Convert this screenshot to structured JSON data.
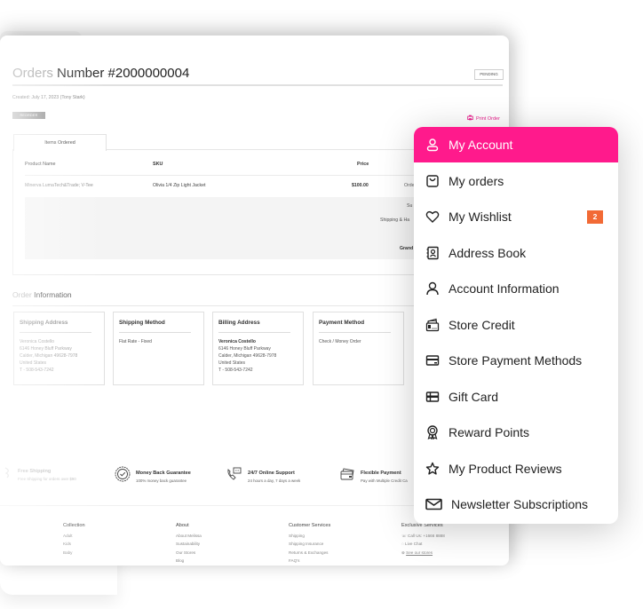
{
  "order": {
    "title_prefix": "Orders",
    "title_main": "Number #2000000004",
    "status": "PENDING",
    "created": "Created: July 17, 2023 (Tony Stark)",
    "reorder_label": "REORDER",
    "print_label": "Print Order"
  },
  "tabs": [
    {
      "label": "Items Ordered"
    }
  ],
  "table": {
    "headers": [
      "Product Name",
      "SKU",
      "Price"
    ],
    "rows": [
      {
        "product": "Minerva LumaTech&Trade; V-Tee",
        "sku": "Olivia 1/4 Zip Light Jacket",
        "price": "$100.00",
        "qty_partial": "Orde"
      }
    ],
    "totals_partial": [
      "Su",
      "Shipping & Ha",
      "Grand"
    ]
  },
  "order_info": {
    "title_prefix": "Order",
    "title_main": "Information",
    "boxes": [
      {
        "title": "Shipping Address",
        "name": "Veronica Costello",
        "lines": [
          "6146 Honey Bluff Parkway",
          "Calder, Michigan 49628-7978",
          "United States",
          "T - 508-543-7242"
        ]
      },
      {
        "title": "Shipping Method",
        "text": "Flat Rate - Fixed"
      },
      {
        "title": "Billing Address",
        "name": "Veronica Costello",
        "lines": [
          "6146 Honey Bluff Parkway",
          "Calder, Michigan 49628-7978",
          "United States",
          "T - 508-543-7242"
        ]
      },
      {
        "title": "Payment Method",
        "text": "Check / Money Order"
      }
    ]
  },
  "features": [
    {
      "title": "Free Shipping",
      "sub": "Free Shipping for orders over $90",
      "icon": "truck-icon"
    },
    {
      "title": "Money Back Guarantee",
      "sub": "100% money back guarantee",
      "icon": "badge-check-icon"
    },
    {
      "title": "24/7 Online Support",
      "sub": "24 hours a day, 7 days a week",
      "icon": "phone-chat-icon"
    },
    {
      "title": "Flexible Payment",
      "sub": "Pay with Multiple Credit Ca",
      "icon": "credit-card-icon"
    }
  ],
  "footer": {
    "columns": [
      {
        "title": "Collection",
        "items": [
          "Adult",
          "Kids",
          "Baby"
        ]
      },
      {
        "title": "About",
        "items": [
          "About Melissa",
          "Sustainability",
          "Our Stores",
          "Blog"
        ]
      },
      {
        "title": "Customer Services",
        "items": [
          "Shipping",
          "Shipping Insurance",
          "Returns & Exchanges",
          "FAQ's"
        ]
      },
      {
        "title": "Exclusive Services",
        "items": [
          "Call Us: +1666 8888",
          "Live Chat",
          "See our stores"
        ]
      }
    ]
  },
  "menu": {
    "accent_color": "#ff1a8c",
    "badge_color": "#f26a35",
    "items": [
      {
        "label": "My Account",
        "icon": "user-icon",
        "active": true
      },
      {
        "label": "My orders",
        "icon": "bag-icon"
      },
      {
        "label": "My Wishlist",
        "icon": "heart-icon",
        "badge": "2"
      },
      {
        "label": "Address Book",
        "icon": "address-book-icon"
      },
      {
        "label": "Account Information",
        "icon": "person-icon"
      },
      {
        "label": "Store Credit",
        "icon": "wallet-icon"
      },
      {
        "label": "Store Payment Methods",
        "icon": "card-icon"
      },
      {
        "label": "Gift Card",
        "icon": "gift-card-icon"
      },
      {
        "label": "Reward Points",
        "icon": "award-icon"
      },
      {
        "label": "My Product Reviews",
        "icon": "star-icon"
      },
      {
        "label": "Newsletter Subscriptions",
        "icon": "envelope-icon"
      }
    ]
  }
}
